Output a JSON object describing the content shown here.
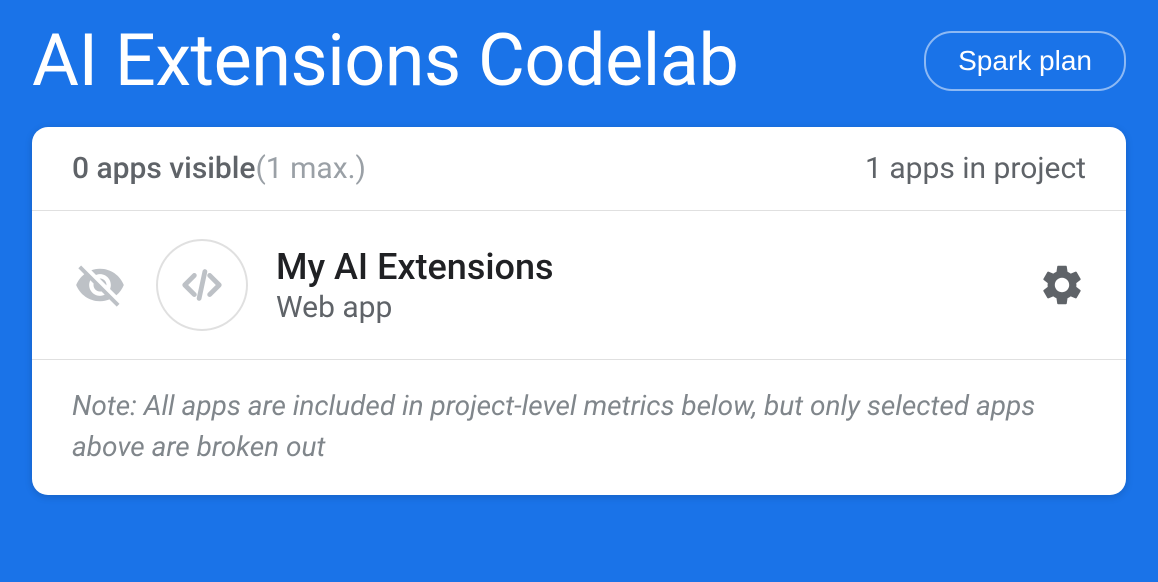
{
  "header": {
    "project_title": "AI Extensions Codelab",
    "plan_label": "Spark plan"
  },
  "card": {
    "apps_visible_count": "0 apps visible",
    "apps_visible_max": "(1 max.)",
    "apps_in_project": "1 apps in project",
    "app": {
      "name": "My AI Extensions",
      "type": "Web app"
    },
    "note": "Note: All apps are included in project-level metrics below, but only selected apps above are broken out"
  }
}
